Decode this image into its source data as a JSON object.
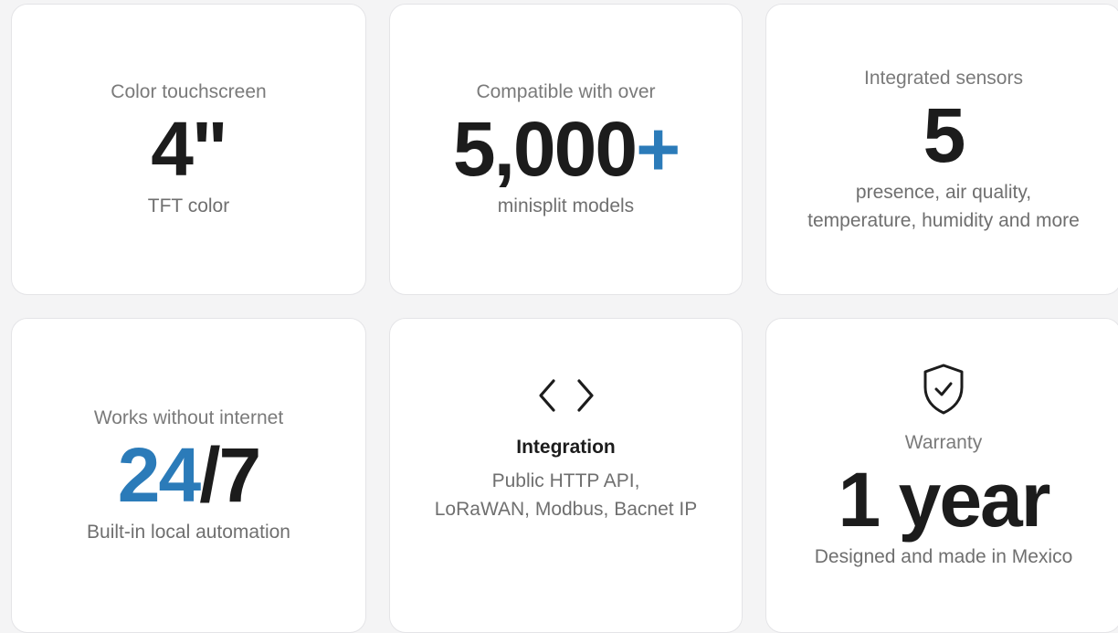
{
  "cards": {
    "touchscreen": {
      "label": "Color touchscreen",
      "value": "4\"",
      "sub": "TFT color"
    },
    "compatibility": {
      "label": "Compatible with over",
      "value": "5,000",
      "value_accent": "+",
      "sub": "minisplit models"
    },
    "sensors": {
      "label": "Integrated sensors",
      "value": "5",
      "sub_line1": "presence, air quality,",
      "sub_line2": "temperature, humidity and more"
    },
    "offline": {
      "label": "Works without internet",
      "value_accent": "24",
      "value": "/7",
      "sub": "Built-in local automation"
    },
    "integration": {
      "icon": "code-icon",
      "heading": "Integration",
      "sub_line1": "Public HTTP API,",
      "sub_line2": "LoRaWAN, Modbus, Bacnet IP"
    },
    "warranty": {
      "icon": "shield-check-icon",
      "label": "Warranty",
      "value": "1 year",
      "sub": "Designed and made in Mexico"
    }
  },
  "colors": {
    "accent": "#2b7bb9",
    "text_dark": "#1c1c1c",
    "text_muted": "#7a7a7a",
    "card_bg": "#ffffff",
    "page_bg": "#f4f4f5"
  }
}
